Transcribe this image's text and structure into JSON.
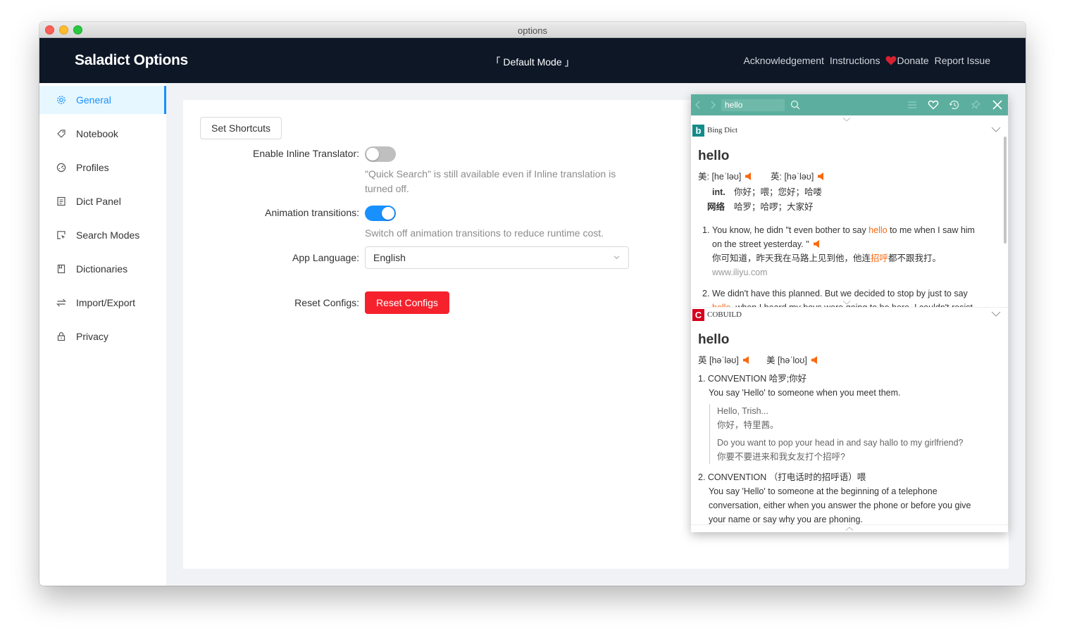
{
  "window": {
    "title": "options"
  },
  "header": {
    "brand": "Saladict Options",
    "mode": "「 Default Mode 」",
    "links": [
      "Acknowledgement",
      "Instructions",
      "Donate",
      "Report Issue"
    ],
    "donate_icon": "heart-icon"
  },
  "sidebar": {
    "active": "General",
    "items": [
      {
        "label": "General",
        "icon": "gear-icon"
      },
      {
        "label": "Notebook",
        "icon": "tag-icon"
      },
      {
        "label": "Profiles",
        "icon": "dashboard-icon"
      },
      {
        "label": "Dict Panel",
        "icon": "panel-icon"
      },
      {
        "label": "Search Modes",
        "icon": "select-icon"
      },
      {
        "label": "Dictionaries",
        "icon": "book-icon"
      },
      {
        "label": "Import/Export",
        "icon": "swap-icon"
      },
      {
        "label": "Privacy",
        "icon": "lock-icon"
      }
    ]
  },
  "form": {
    "set_shortcuts_label": "Set Shortcuts",
    "inline_translator": {
      "label": "Enable Inline Translator",
      "enabled": false,
      "help": "\"Quick Search\" is still available even if Inline translation is turned off."
    },
    "animation": {
      "label": "Animation transitions",
      "enabled": true,
      "help": "Switch off animation transitions to reduce runtime cost."
    },
    "app_language": {
      "label": "App Language",
      "value": "English"
    },
    "reset": {
      "label": "Reset Configs",
      "button": "Reset Configs"
    }
  },
  "panel": {
    "search_text": "hello",
    "colors": {
      "menubar": "#5caf9e",
      "highlight": "#f9690e",
      "danger": "#f5222d",
      "accent": "#1890ff"
    },
    "bing": {
      "name": "Bing Dict",
      "word": "hello",
      "us_phonetic": "美: [heˈləʊ]",
      "uk_phonetic": "英: [həˈləʊ]",
      "meanings": [
        {
          "pos": "int.",
          "text": "你好；喂；您好；哈喽"
        },
        {
          "pos": "网络",
          "text": "哈罗；哈啰；大家好"
        }
      ],
      "examples": [
        {
          "num": "1.",
          "en_before": "You know, he didn \"t even bother to say ",
          "en_word": "hello",
          "en_after": " to me when I saw him",
          "en_line2": "on the street yesterday. \"",
          "zh_before": "你可知道，昨天我在马路上见到他，他连",
          "zh_word": "招呼",
          "zh_after": "都不跟我打。",
          "source": "www.iliyu.com"
        },
        {
          "num": "2.",
          "en": "We didn't have this planned. But we decided to stop by just to say",
          "en_line2_word": "hello",
          "en_line2": ", when I heard my boys were going to be here, I couldn't resist"
        }
      ]
    },
    "cobuild": {
      "name": "COBUILD",
      "word": "hello",
      "uk_phonetic": "英 [həˈləʊ]",
      "us_phonetic": "美 [həˈloʊ]",
      "senses": [
        {
          "heading": "1. CONVENTION 哈罗;你好",
          "def": "You say 'Hello' to someone when you meet them.",
          "examples": [
            {
              "en": "Hello, Trish...",
              "zh": "你好，特里茜。"
            },
            {
              "en": "Do you want to pop your head in and say hallo to my girlfriend?",
              "zh": "你要不要进来和我女友打个招呼?"
            }
          ]
        },
        {
          "heading": "2. CONVENTION （打电话时的招呼语）喂",
          "def_lines": [
            "You say 'Hello' to someone at the beginning of a telephone",
            "conversation, either when you answer the phone or before you give",
            "your name or say why you are phoning."
          ]
        }
      ]
    }
  }
}
